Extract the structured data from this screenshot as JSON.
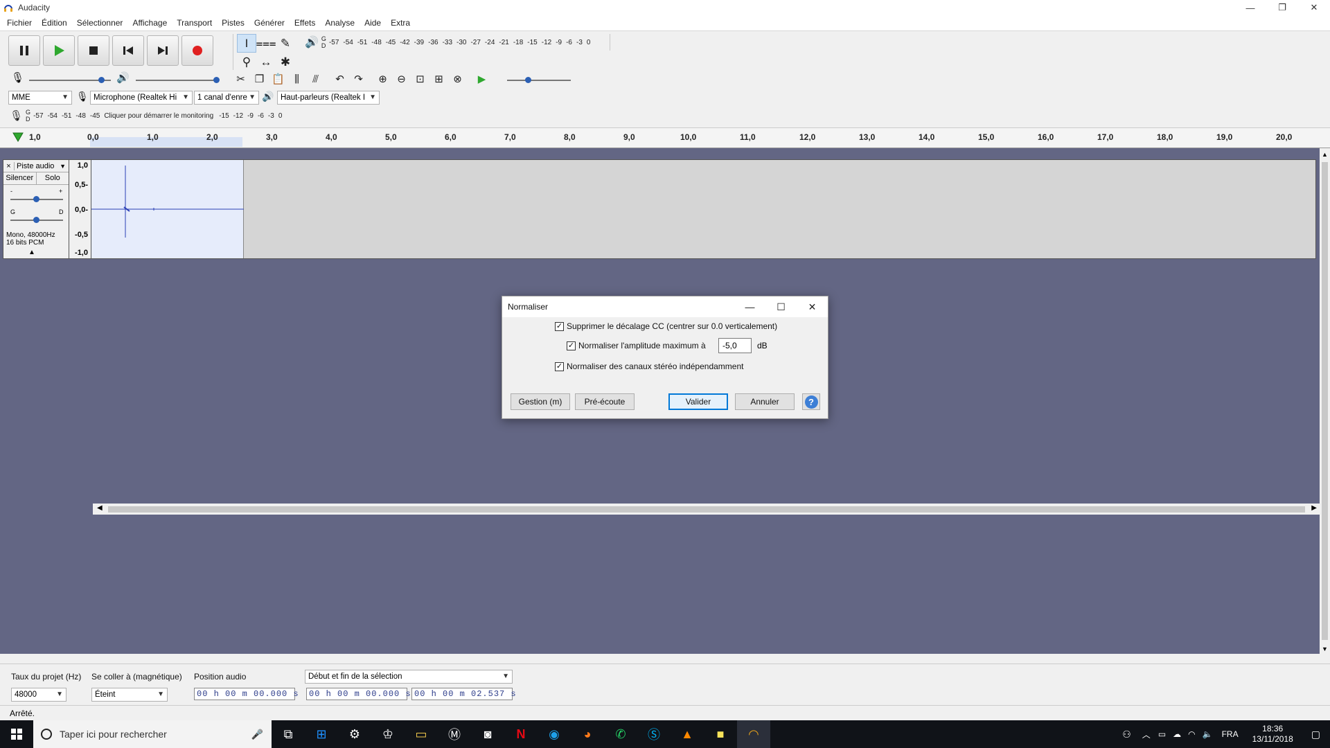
{
  "window": {
    "title": "Audacity"
  },
  "menu": [
    "Fichier",
    "Édition",
    "Sélectionner",
    "Affichage",
    "Transport",
    "Pistes",
    "Générer",
    "Effets",
    "Analyse",
    "Aide",
    "Extra"
  ],
  "meters": {
    "playback_ticks": [
      "-57",
      "-54",
      "-51",
      "-48",
      "-45",
      "-42",
      "-39",
      "-36",
      "-33",
      "-30",
      "-27",
      "-24",
      "-21",
      "-18",
      "-15",
      "-12",
      "-9",
      "-6",
      "-3",
      "0"
    ],
    "record_ticks_left": [
      "-57",
      "-54",
      "-51",
      "-48",
      "-45"
    ],
    "record_prompt": "Cliquer pour démarrer le monitoring",
    "record_ticks_right": [
      "-15",
      "-12",
      "-9",
      "-6",
      "-3",
      "0"
    ],
    "channel_top": "G",
    "channel_bottom": "D"
  },
  "devices": {
    "host": "MME",
    "mic": "Microphone (Realtek Hi",
    "channels": "1 canal d'enre",
    "speakers": "Haut-parleurs (Realtek I"
  },
  "ruler": {
    "labels": [
      "1,0",
      "0,0",
      "1,0",
      "2,0",
      "3,0",
      "4,0",
      "5,0",
      "6,0",
      "7,0",
      "8,0",
      "9,0",
      "10,0",
      "11,0",
      "12,0",
      "13,0",
      "14,0",
      "15,0",
      "16,0",
      "17,0",
      "18,0",
      "19,0",
      "20,0"
    ]
  },
  "track": {
    "name": "Piste audio",
    "close": "×",
    "mute": "Silencer",
    "solo": "Solo",
    "gain_minus": "-",
    "gain_plus": "+",
    "pan_left": "G",
    "pan_right": "D",
    "info1": "Mono, 48000Hz",
    "info2": "16 bits PCM",
    "vruler": [
      "1,0",
      "0,5-",
      "0,0-",
      "-0,5",
      "-1,0"
    ]
  },
  "dialog": {
    "title": "Normaliser",
    "opt_dc": "Supprimer le décalage CC (centrer sur 0.0 verticalement)",
    "opt_amp": "Normaliser l'amplitude maximum à",
    "amp_value": "-5,0",
    "amp_unit": "dB",
    "opt_stereo": "Normaliser des canaux stéréo indépendamment",
    "btn_manage": "Gestion (m)",
    "btn_preview": "Pré-écoute",
    "btn_ok": "Valider",
    "btn_cancel": "Annuler",
    "help": "?"
  },
  "selection": {
    "rate_label": "Taux du projet (Hz)",
    "rate_value": "48000",
    "snap_label": "Se coller à (magnétique)",
    "snap_value": "Éteint",
    "pos_label": "Position audio",
    "mode_value": "Début et fin de la sélection",
    "pos_time": "00 h 00 m 00.000 s",
    "start_time": "00 h 00 m 00.000 s",
    "end_time": "00 h 00 m 02.537 s"
  },
  "status": "Arrêté.",
  "taskbar": {
    "search_placeholder": "Taper ici pour rechercher",
    "lang": "FRA",
    "time": "18:36",
    "date": "13/11/2018"
  },
  "colors": {
    "accent": "#0078d7",
    "track_bg": "#636684",
    "record": "#e02020",
    "play": "#2fa82f"
  }
}
